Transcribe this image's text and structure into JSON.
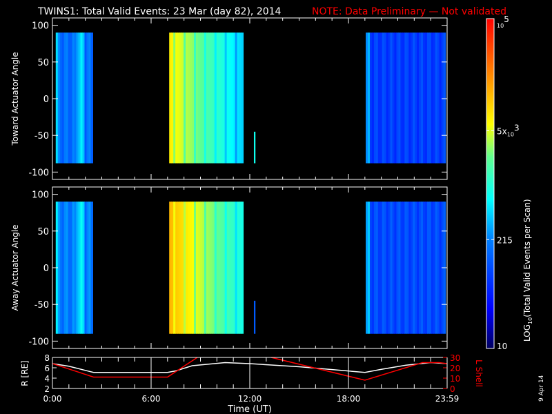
{
  "title": {
    "main": "TWINS1: Total Valid Events: 23 Mar (day  82), 2014",
    "note": "NOTE: Data Preliminary — Not validated"
  },
  "colors": {
    "note": "#ff0000",
    "lshell": "#ff0000",
    "radius": "#ffffff",
    "background": "#000000"
  },
  "chart_data": [
    {
      "type": "heatmap",
      "name": "toward",
      "ylabel": "Toward Actuator Angle",
      "ylim": [
        -110,
        110
      ],
      "yticks": [
        "100",
        "50",
        "0",
        "-50",
        "-100"
      ],
      "ytick_values": [
        100,
        50,
        0,
        -50,
        -100
      ],
      "xlim_hours": [
        0,
        24
      ],
      "angle_range": [
        -88,
        90
      ],
      "blocks": [
        {
          "start": 0.2,
          "end": 2.45,
          "level": 0.3
        },
        {
          "start": 7.1,
          "end": 11.6,
          "level": 0.65
        },
        {
          "start": 12.25,
          "end": 12.32,
          "level": 0.35,
          "angle_range": [
            -88,
            -45
          ]
        },
        {
          "start": 19.05,
          "end": 23.9,
          "level": 0.22
        }
      ]
    },
    {
      "type": "heatmap",
      "name": "away",
      "ylabel": "Away Actuator Angle",
      "ylim": [
        -110,
        110
      ],
      "yticks": [
        "100",
        "50",
        "0",
        "-50",
        "-100"
      ],
      "ytick_values": [
        100,
        50,
        0,
        -50,
        -100
      ],
      "xlim_hours": [
        0,
        24
      ],
      "angle_range": [
        -90,
        90
      ],
      "blocks": [
        {
          "start": 0.2,
          "end": 2.45,
          "level": 0.32
        },
        {
          "start": 7.1,
          "end": 11.6,
          "level": 0.72
        },
        {
          "start": 12.25,
          "end": 12.32,
          "level": 0.15,
          "angle_range": [
            -90,
            -45
          ]
        },
        {
          "start": 19.05,
          "end": 23.9,
          "level": 0.24
        }
      ]
    },
    {
      "type": "line",
      "name": "orbit",
      "ylabel": "R [RE]",
      "ylim": [
        2,
        8
      ],
      "yticks": [
        "8",
        "6",
        "4",
        "2"
      ],
      "ytick_values": [
        8,
        6,
        4,
        2
      ],
      "y2label": "L Shell",
      "y2lim": [
        0,
        30
      ],
      "y2ticks": [
        "30",
        "20",
        "10",
        "0"
      ],
      "y2tick_values": [
        30,
        20,
        10,
        0
      ],
      "xlabel": "Time (UT)",
      "xticks": [
        "0:00",
        "6:00",
        "12:00",
        "18:00",
        "23:59"
      ],
      "xtick_hours": [
        0,
        6,
        12,
        18,
        24
      ],
      "series": [
        {
          "name": "R",
          "x": [
            0,
            1,
            2.5,
            7,
            7.5,
            8.5,
            10.5,
            12,
            15,
            19,
            20,
            21.5,
            23,
            24
          ],
          "y": [
            6.8,
            6.3,
            5.1,
            5.1,
            5.4,
            6.4,
            7.0,
            6.8,
            6.2,
            5.1,
            5.7,
            6.5,
            7.0,
            6.8
          ]
        },
        {
          "name": "L Shell",
          "x": [
            0,
            2.5,
            7,
            9
          ],
          "y": [
            24,
            11,
            11,
            32
          ]
        },
        {
          "name": "L Shell",
          "x": [
            13.3,
            19,
            22.5,
            23.5,
            24
          ],
          "y": [
            30,
            8,
            25,
            25,
            24
          ]
        }
      ]
    },
    {
      "type": "colorbar",
      "label": "LOG10(Total Valid Events per Scan)",
      "label_main": "LOG",
      "label_sub": "10",
      "label_rest": "(Total Valid Events per Scan)",
      "ticks": [
        {
          "base": "10",
          "exp": "5",
          "prefix": "",
          "level": 1.0
        },
        {
          "base": "10",
          "exp": "3",
          "prefix": "5x",
          "level": 0.66
        },
        {
          "base": "215",
          "exp": "",
          "prefix": "",
          "level": 0.33
        },
        {
          "base": "10",
          "exp": "",
          "prefix": "",
          "level": 0.0
        }
      ]
    }
  ],
  "footer": {
    "date_stamp": "9 Apr 14"
  }
}
